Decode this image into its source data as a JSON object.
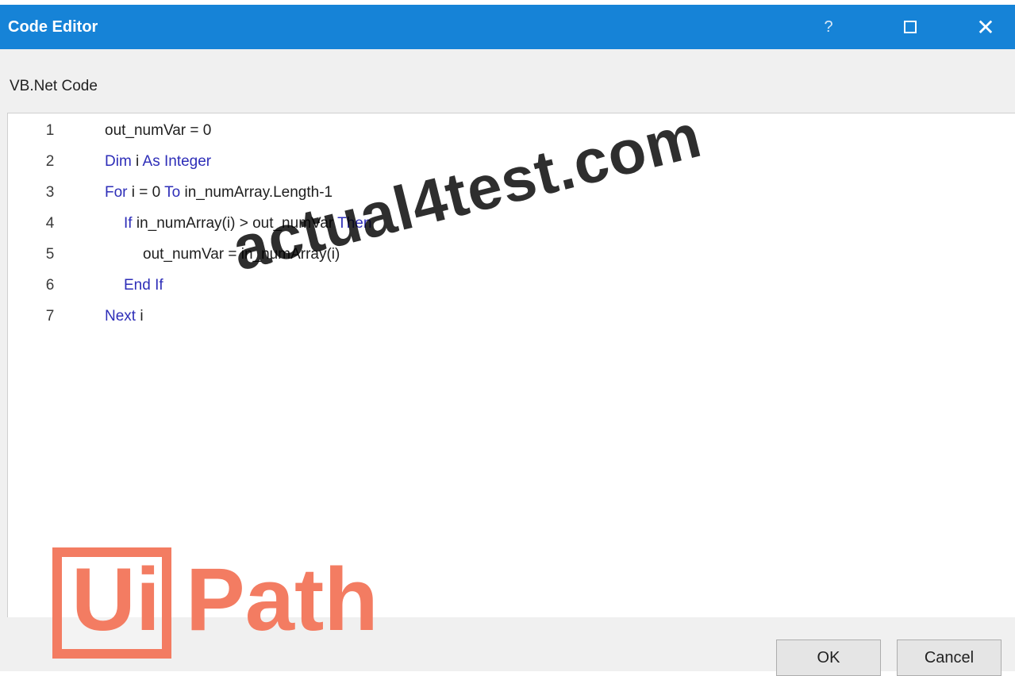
{
  "window": {
    "title": "Code Editor",
    "help_glyph": "?",
    "close_glyph": "✕"
  },
  "editor": {
    "language_label": "VB.Net Code",
    "lines": [
      {
        "num": "1",
        "parts": [
          {
            "t": "out_numVar = 0",
            "kw": false
          }
        ],
        "indent": 0
      },
      {
        "num": "2",
        "parts": [
          {
            "t": "Dim",
            "kw": true
          },
          {
            "t": " i ",
            "kw": false
          },
          {
            "t": "As Integer",
            "kw": true
          }
        ],
        "indent": 0
      },
      {
        "num": "3",
        "parts": [
          {
            "t": "For",
            "kw": true
          },
          {
            "t": " i = 0 ",
            "kw": false
          },
          {
            "t": "To",
            "kw": true
          },
          {
            "t": " in_numArray.Length-1",
            "kw": false
          }
        ],
        "indent": 0
      },
      {
        "num": "4",
        "parts": [
          {
            "t": "If",
            "kw": true
          },
          {
            "t": " in_numArray(i) > out_numVar ",
            "kw": false
          },
          {
            "t": "Then",
            "kw": true
          }
        ],
        "indent": 1
      },
      {
        "num": "5",
        "parts": [
          {
            "t": "out_numVar = in_numArray(i)",
            "kw": false
          }
        ],
        "indent": 2
      },
      {
        "num": "6",
        "parts": [
          {
            "t": "End If",
            "kw": true
          }
        ],
        "indent": 1
      },
      {
        "num": "7",
        "parts": [
          {
            "t": "Next",
            "kw": true
          },
          {
            "t": " i",
            "kw": false
          }
        ],
        "indent": 0
      }
    ]
  },
  "watermark": "actual4test.com",
  "logo": {
    "ui": "Ui",
    "path": "Path"
  },
  "buttons": {
    "ok": "OK",
    "cancel": "Cancel"
  },
  "colors": {
    "titlebar": "#1683d7",
    "keyword": "#2e2eb8",
    "logo": "#f37c62"
  }
}
